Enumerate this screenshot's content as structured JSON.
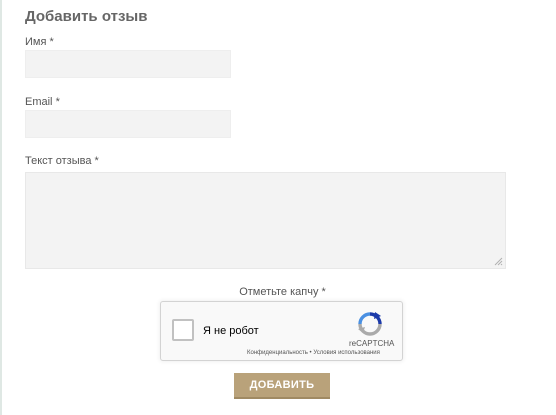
{
  "form": {
    "title": "Добавить отзыв",
    "name_label": "Имя",
    "email_label": "Email",
    "review_label": "Текст отзыва",
    "required_mark": "*",
    "name_value": "",
    "email_value": "",
    "review_value": ""
  },
  "captcha": {
    "label": "Отметьте капчу *",
    "checkbox_text": "Я не робот",
    "brand": "reCAPTCHA",
    "privacy_link": "Конфиденциальность",
    "separator": " • ",
    "terms_link": "Условия использования",
    "logo_icon": "recaptcha-logo-icon"
  },
  "actions": {
    "submit_label": "ДОБАВИТЬ"
  },
  "colors": {
    "button_bg": "#b9a27a",
    "input_bg": "#f3f3f3",
    "recaptcha_blue": "#1c3aa9",
    "recaptcha_lightblue": "#4a90e2",
    "recaptcha_gray": "#aaaaaa"
  }
}
